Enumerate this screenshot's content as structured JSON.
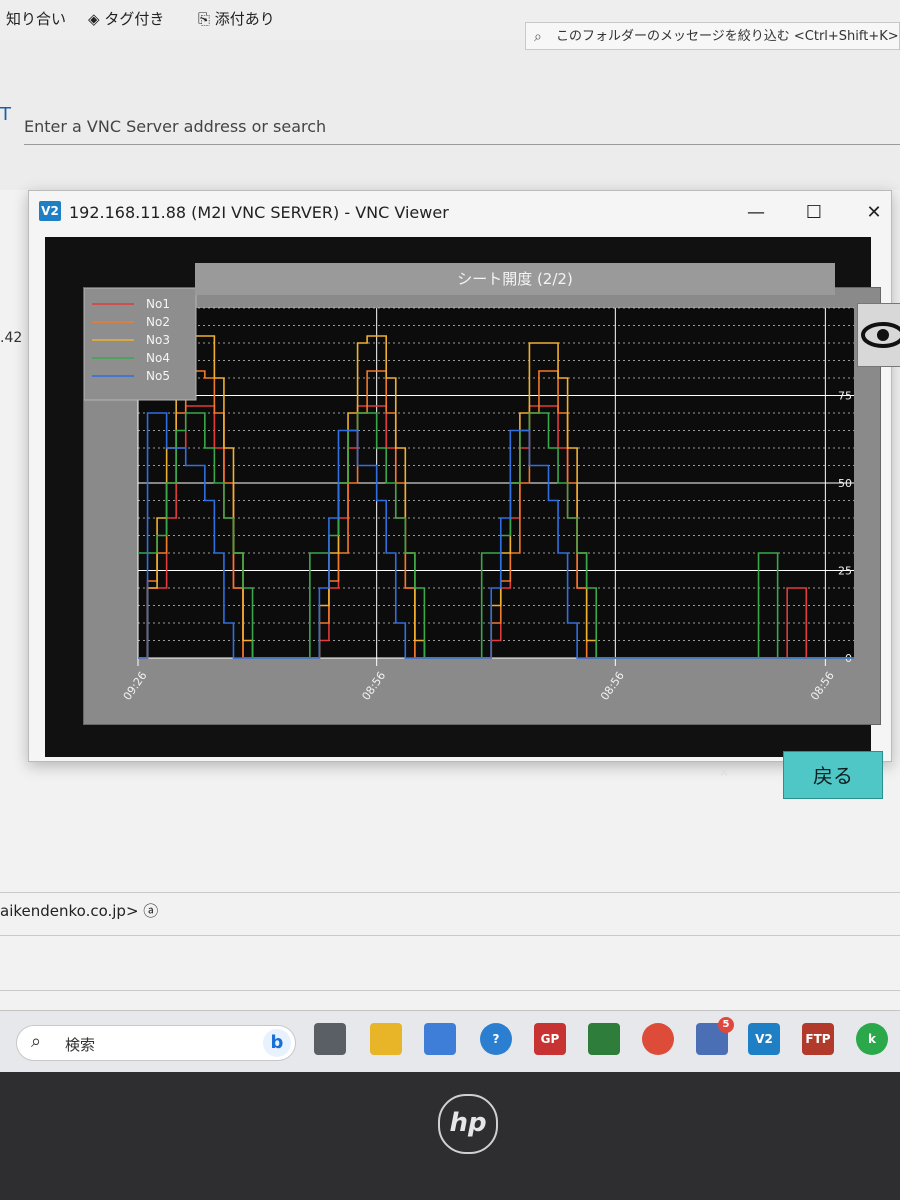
{
  "mail_toolbar": {
    "filter_known": "知り合い",
    "filter_tagged": "タグ付き",
    "filter_attach": "添付あり",
    "search_placeholder": "このフォルダーのメッセージを絞り込む <Ctrl+Shift+K>"
  },
  "vnc_app": {
    "address_placeholder": "Enter a VNC Server address or search",
    "side_fragment": ".42"
  },
  "vnc_window": {
    "logo": "V2",
    "title": "192.168.11.88 (M2I VNC SERVER) - VNC Viewer",
    "minimize_glyph": "—",
    "maximize_glyph": "☐",
    "close_glyph": "✕",
    "back_button": "戻る",
    "small_close": "×"
  },
  "email_snippet": "aikendenko.co.jp> ⓐ",
  "taskbar": {
    "search_placeholder": "検索",
    "mail_badge": "5",
    "icons": [
      "task-view-icon",
      "file-explorer-icon",
      "store-icon",
      "help-icon",
      "gp-icon",
      "sheet-icon",
      "chrome-icon",
      "mail-icon",
      "vnc-icon",
      "ftp-icon",
      "k-icon"
    ]
  },
  "bezel_logo": "hp",
  "chart_data": {
    "type": "line",
    "title": "シート開度 (2/2)",
    "xlabel": "",
    "ylabel": "",
    "x_ticks": [
      "09:26",
      "08:56",
      "08:56",
      "08:56"
    ],
    "y_ticks": [
      0,
      25,
      50,
      75
    ],
    "ylim": [
      0,
      100
    ],
    "grid": true,
    "legend_position": "top-left",
    "series_colors": {
      "No1": "#e23b3b",
      "No2": "#f07a2a",
      "No3": "#f0b030",
      "No4": "#3aa84a",
      "No5": "#2f6fe0"
    },
    "x": [
      0,
      1,
      2,
      3,
      4,
      5,
      6,
      7,
      8,
      9,
      10,
      11,
      12,
      13,
      14,
      15,
      16,
      17,
      18,
      19,
      20,
      21,
      22,
      23,
      24,
      25,
      26,
      27,
      28,
      29,
      30,
      31,
      32,
      33,
      34,
      35,
      36,
      37,
      38,
      39,
      40,
      41,
      42,
      43,
      44,
      45,
      46,
      47,
      48,
      49,
      50,
      51,
      52,
      53,
      54,
      55,
      56,
      57,
      58,
      59,
      60,
      61,
      62,
      63,
      64,
      65,
      66,
      67,
      68,
      69,
      70,
      71,
      72,
      73,
      74,
      75
    ],
    "series": [
      {
        "name": "No1",
        "values": [
          0,
          20,
          20,
          40,
          60,
          72,
          72,
          72,
          60,
          40,
          20,
          0,
          0,
          0,
          0,
          0,
          0,
          0,
          0,
          5,
          20,
          40,
          60,
          72,
          72,
          72,
          60,
          40,
          20,
          0,
          0,
          0,
          0,
          0,
          0,
          0,
          0,
          5,
          20,
          40,
          60,
          72,
          72,
          72,
          60,
          40,
          20,
          0,
          0,
          0,
          0,
          0,
          0,
          0,
          0,
          0,
          0,
          0,
          0,
          0,
          0,
          0,
          0,
          0,
          0,
          0,
          0,
          0,
          20,
          20,
          0,
          0,
          0,
          0,
          0,
          0
        ]
      },
      {
        "name": "No2",
        "values": [
          0,
          22,
          30,
          50,
          70,
          80,
          82,
          80,
          70,
          50,
          20,
          0,
          0,
          0,
          0,
          0,
          0,
          0,
          0,
          10,
          22,
          30,
          50,
          70,
          82,
          82,
          70,
          50,
          20,
          0,
          0,
          0,
          0,
          0,
          0,
          0,
          0,
          10,
          22,
          30,
          50,
          70,
          82,
          82,
          70,
          50,
          20,
          0,
          0,
          0,
          0,
          0,
          0,
          0,
          0,
          0,
          0,
          0,
          0,
          0,
          0,
          0,
          0,
          0,
          0,
          0,
          0,
          0,
          0,
          0,
          0,
          0,
          0,
          0,
          0,
          0
        ]
      },
      {
        "name": "No3",
        "values": [
          0,
          20,
          40,
          60,
          80,
          92,
          92,
          92,
          80,
          60,
          30,
          5,
          0,
          0,
          0,
          0,
          0,
          0,
          0,
          15,
          30,
          50,
          70,
          90,
          92,
          92,
          80,
          60,
          30,
          5,
          0,
          0,
          0,
          0,
          0,
          0,
          0,
          15,
          30,
          50,
          70,
          90,
          90,
          90,
          80,
          60,
          30,
          5,
          0,
          0,
          0,
          0,
          0,
          0,
          0,
          0,
          0,
          0,
          0,
          0,
          0,
          0,
          0,
          0,
          0,
          0,
          0,
          0,
          0,
          0,
          0,
          0,
          0,
          0,
          0,
          0
        ]
      },
      {
        "name": "No4",
        "values": [
          30,
          30,
          35,
          50,
          65,
          70,
          70,
          60,
          50,
          40,
          30,
          20,
          0,
          0,
          0,
          0,
          0,
          0,
          30,
          30,
          35,
          50,
          65,
          70,
          70,
          60,
          50,
          40,
          30,
          20,
          0,
          0,
          0,
          0,
          0,
          0,
          30,
          30,
          35,
          50,
          65,
          70,
          70,
          60,
          50,
          40,
          30,
          20,
          0,
          0,
          0,
          0,
          0,
          0,
          0,
          0,
          0,
          0,
          0,
          0,
          0,
          0,
          0,
          0,
          0,
          30,
          30,
          0,
          0,
          0,
          0,
          0,
          0,
          0,
          0,
          0
        ]
      },
      {
        "name": "No5",
        "values": [
          0,
          70,
          70,
          60,
          60,
          55,
          55,
          45,
          30,
          10,
          0,
          0,
          0,
          0,
          0,
          0,
          0,
          0,
          0,
          20,
          40,
          65,
          65,
          55,
          55,
          45,
          30,
          10,
          0,
          0,
          0,
          0,
          0,
          0,
          0,
          0,
          0,
          20,
          40,
          65,
          65,
          55,
          55,
          45,
          30,
          10,
          0,
          0,
          0,
          0,
          0,
          0,
          0,
          0,
          0,
          0,
          0,
          0,
          0,
          0,
          0,
          0,
          0,
          0,
          0,
          0,
          0,
          0,
          0,
          0,
          0,
          0,
          0,
          0,
          0,
          0
        ]
      }
    ]
  }
}
